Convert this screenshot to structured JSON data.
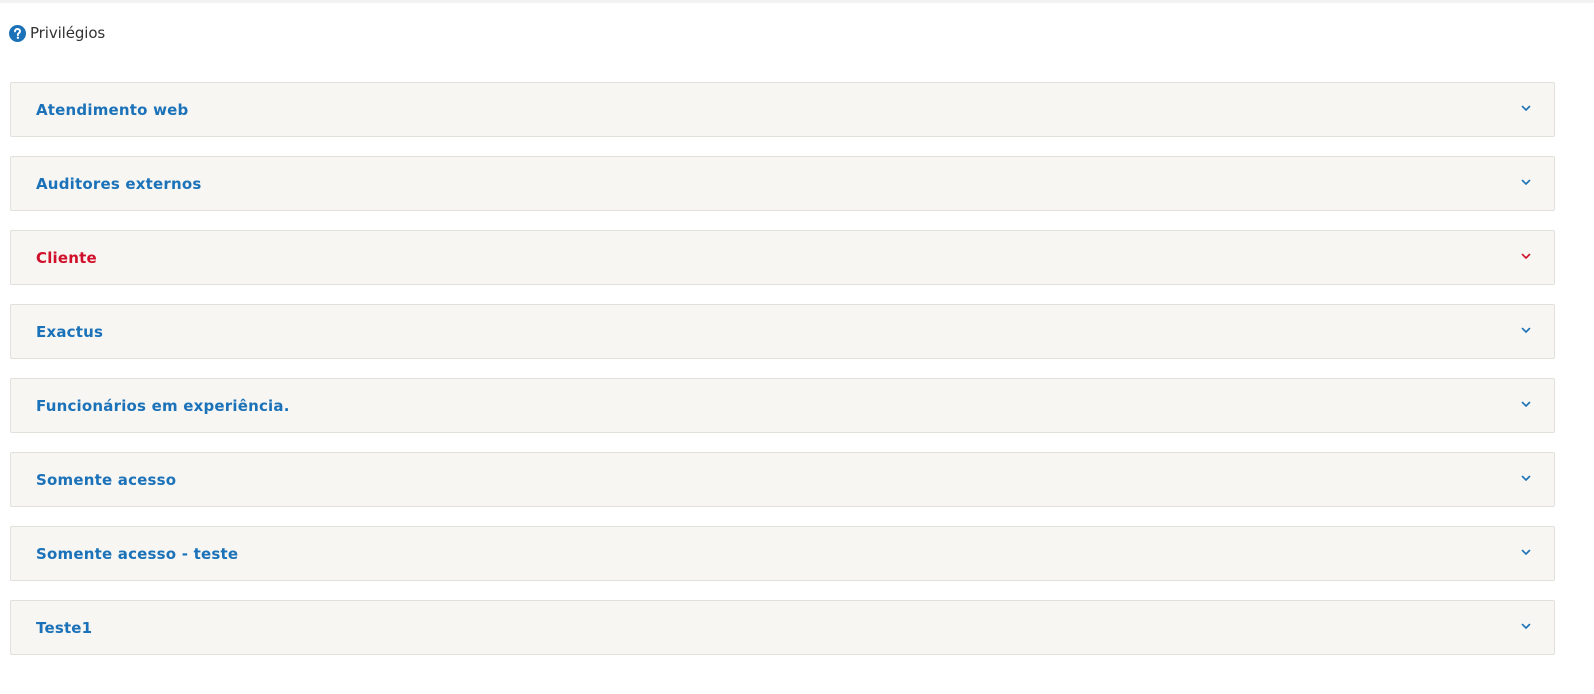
{
  "header": {
    "title": "Privilégios",
    "icon": "help-circle-icon",
    "icon_color": "#1b72b8"
  },
  "colors": {
    "accent": "#1b72b8",
    "active": "#d0102a",
    "panel_bg": "#f7f6f3",
    "panel_border": "#e2e0db"
  },
  "groups": [
    {
      "label": "Atendimento web",
      "active": false,
      "icon": "chevron-down-icon"
    },
    {
      "label": "Auditores externos",
      "active": false,
      "icon": "chevron-down-icon"
    },
    {
      "label": "Cliente",
      "active": true,
      "icon": "chevron-down-icon"
    },
    {
      "label": "Exactus",
      "active": false,
      "icon": "chevron-down-icon"
    },
    {
      "label": "Funcionários em experiência.",
      "active": false,
      "icon": "chevron-down-icon"
    },
    {
      "label": "Somente acesso",
      "active": false,
      "icon": "chevron-down-icon"
    },
    {
      "label": "Somente acesso - teste",
      "active": false,
      "icon": "chevron-down-icon"
    },
    {
      "label": "Teste1",
      "active": false,
      "icon": "chevron-down-icon"
    }
  ]
}
